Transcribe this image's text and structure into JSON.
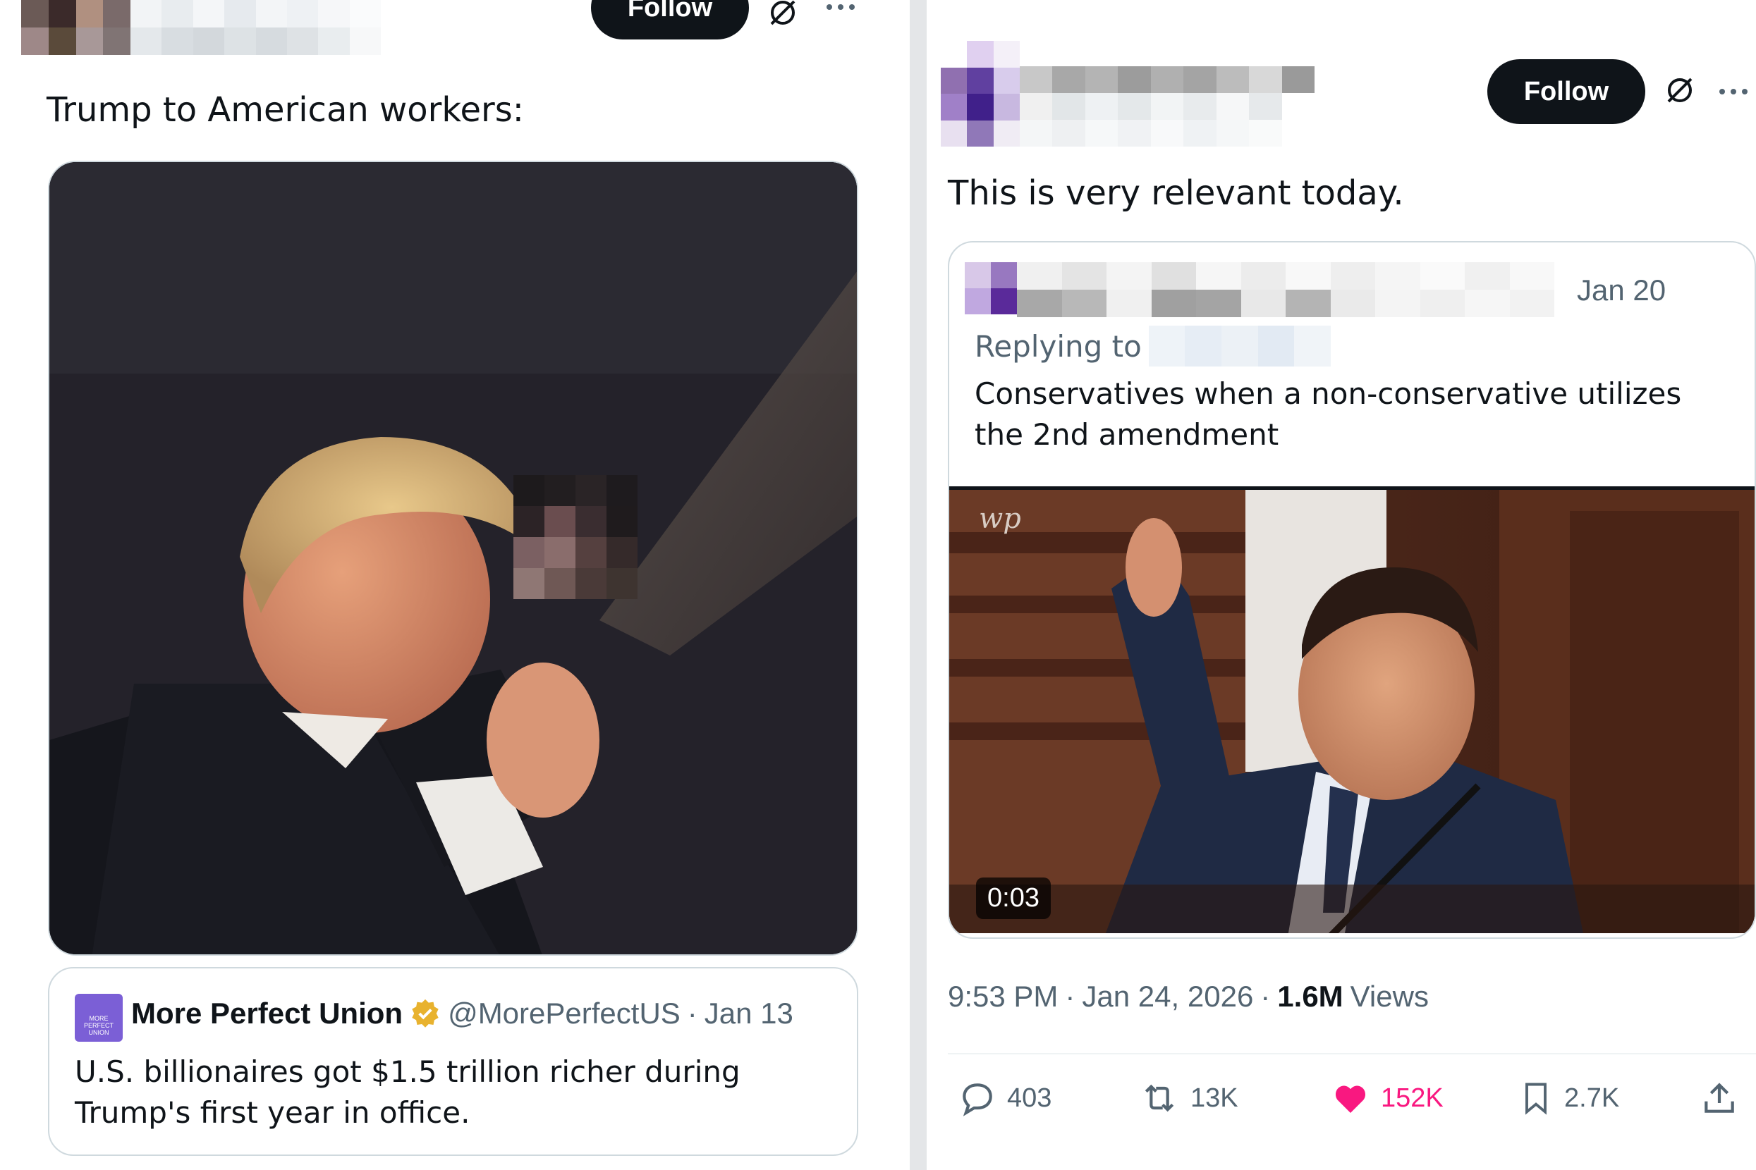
{
  "left_tweet": {
    "follow_label": "Follow",
    "text": "Trump to American workers:",
    "quoted": {
      "author_name": "More Perfect Union",
      "author_handle": "@MorePerfectUS",
      "separator": "·",
      "date": "Jan 13",
      "logo_text": "MORE PERFECT UNION",
      "text": "U.S. billionaires got $1.5 trillion richer during Trump's first year in office."
    }
  },
  "right_tweet": {
    "follow_label": "Follow",
    "text": "This is very relevant today.",
    "quoted": {
      "date": "Jan 20",
      "replying_to_label": "Replying to",
      "text": "Conservatives when a non-conservative utilizes the 2nd amendment",
      "video_watermark": "wp",
      "video_duration": "0:03"
    },
    "meta": {
      "time": "9:53 PM",
      "separator": "·",
      "date": "Jan 24, 2026",
      "views_count": "1.6M",
      "views_label": "Views"
    },
    "actions": {
      "replies": "403",
      "reposts": "13K",
      "likes": "152K",
      "bookmarks": "2.7K"
    }
  },
  "colors": {
    "follow_bg": "#0f1419",
    "like": "#f91880",
    "muted": "#536471",
    "verified_gold": "#e8b22e",
    "border": "#cfd9de"
  },
  "icons": [
    "grok-icon",
    "more-icon",
    "verified-badge-icon",
    "reply-icon",
    "repost-icon",
    "heart-icon",
    "bookmark-icon",
    "share-icon"
  ]
}
